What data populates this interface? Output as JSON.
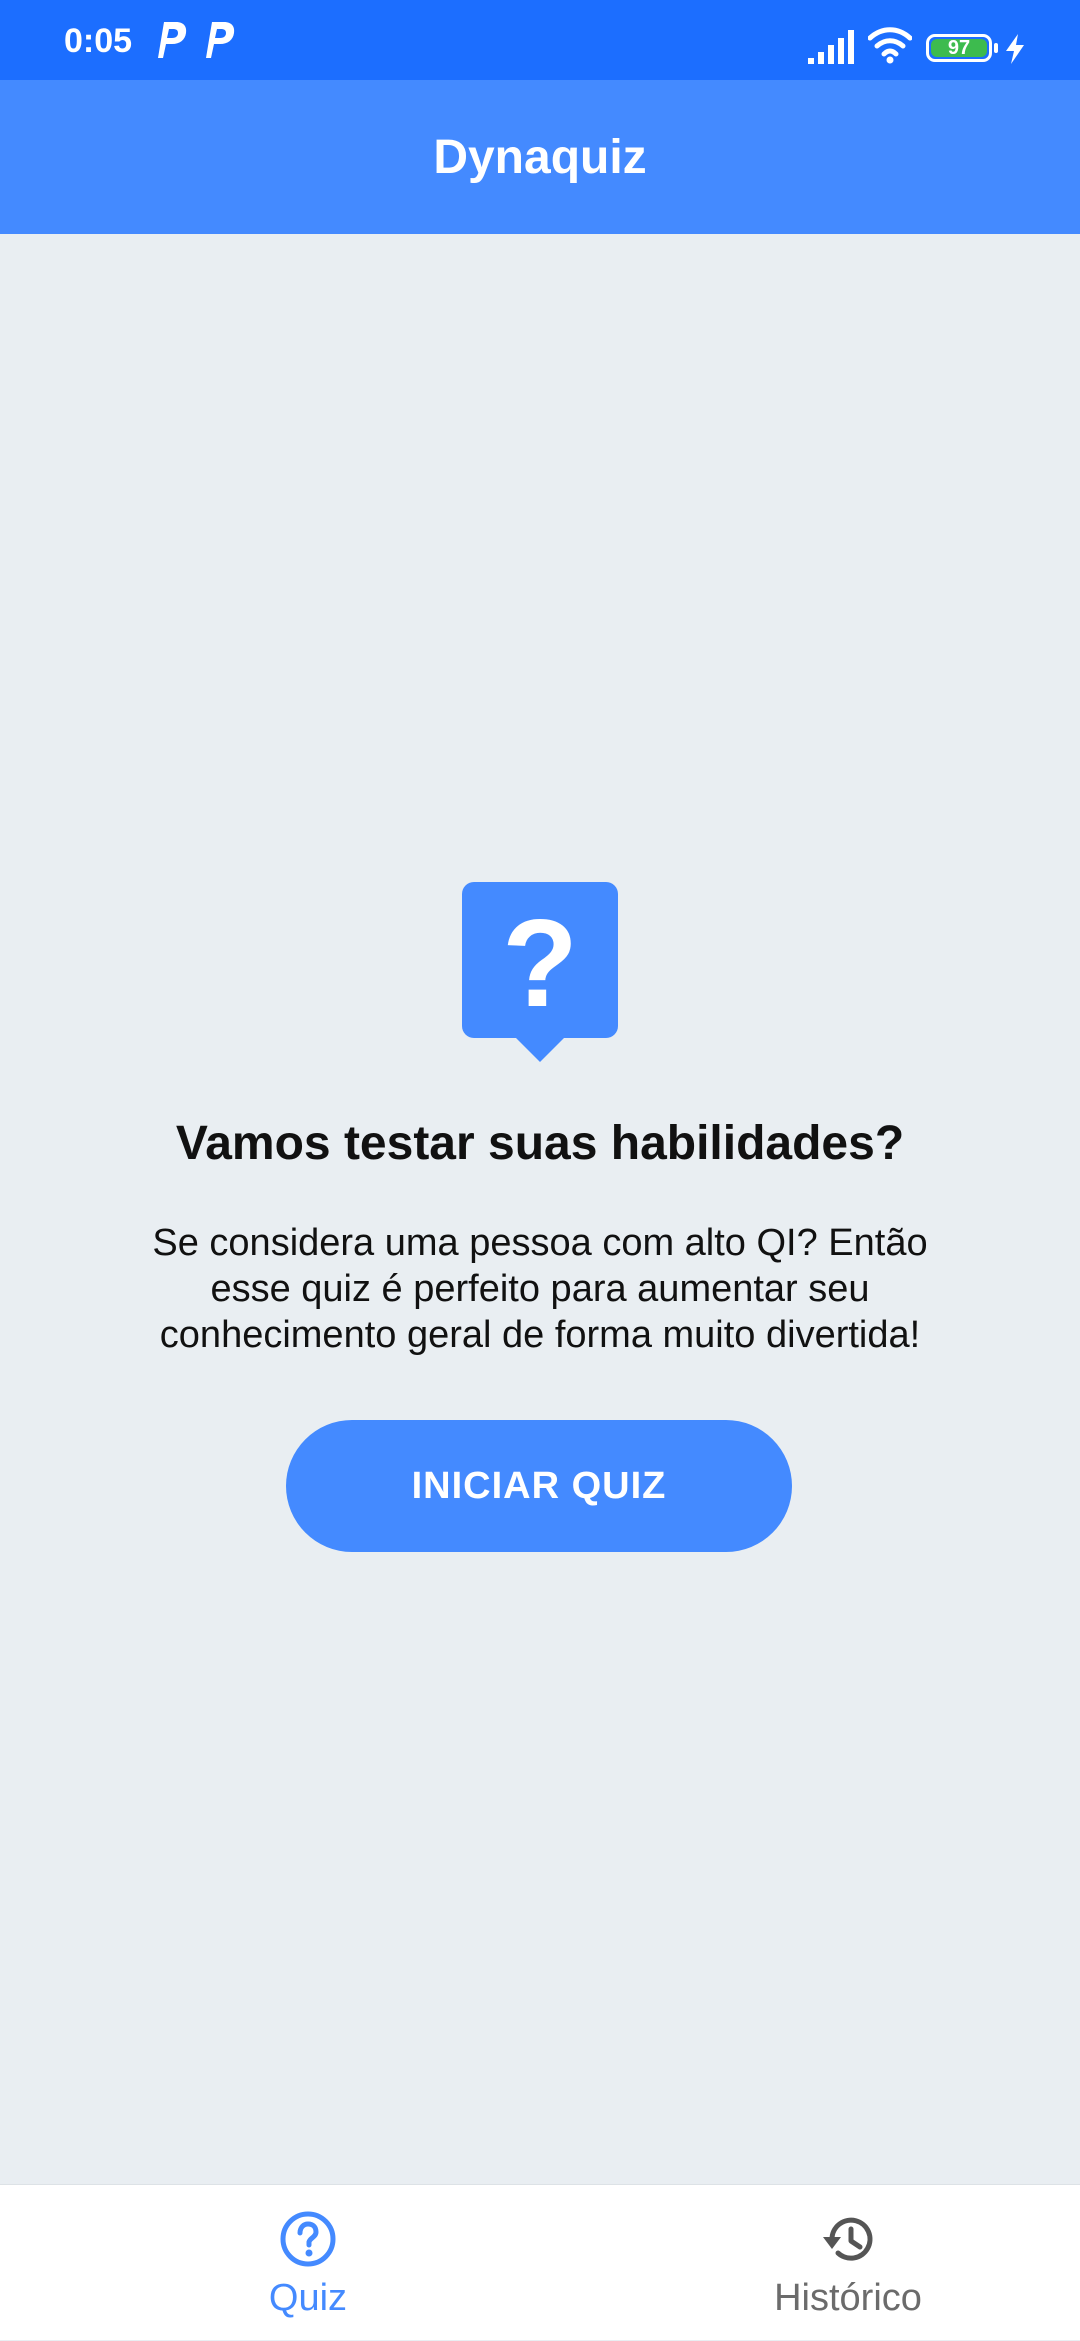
{
  "status_bar": {
    "time": "0:05",
    "battery_level": "97",
    "icons": [
      "parking-icon",
      "parking-icon",
      "signal-icon",
      "wifi-icon",
      "battery-icon",
      "charging-icon"
    ]
  },
  "app_bar": {
    "title": "Dynaquiz"
  },
  "main": {
    "icon": "question-speech-bubble-icon",
    "headline": "Vamos testar suas habilidades?",
    "description": "Se considera uma pessoa com alto QI? Então esse quiz é perfeito para aumentar seu conhecimento geral de forma muito divertida!",
    "start_button_label": "INICIAR QUIZ"
  },
  "bottom_nav": {
    "items": [
      {
        "label": "Quiz",
        "icon": "help-circle-icon",
        "active": true
      },
      {
        "label": "Histórico",
        "icon": "history-icon",
        "active": false
      }
    ]
  },
  "colors": {
    "status_bar": "#1C6EFF",
    "primary": "#448AFF",
    "background": "#E9EEF2",
    "inactive": "#6B6B6B",
    "battery": "#3DBB4E"
  }
}
